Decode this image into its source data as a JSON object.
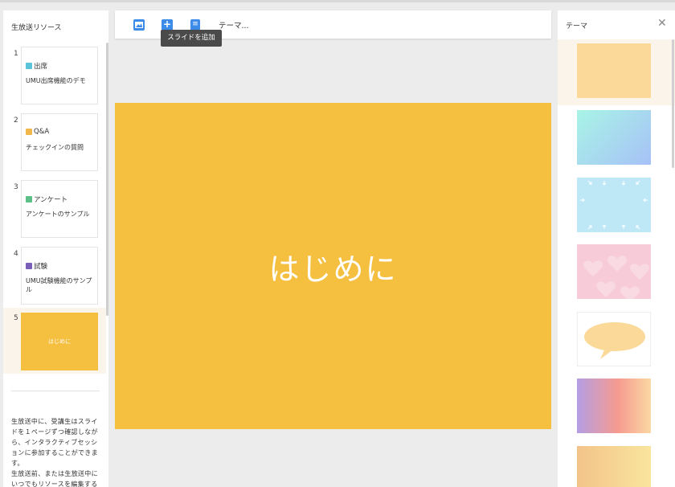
{
  "left_panel": {
    "title": "生放送リソース",
    "slides": [
      {
        "num": "1",
        "type": "出席",
        "color": "#5bc4d8",
        "subtitle": "UMU出席機能のデモ"
      },
      {
        "num": "2",
        "type": "Q&A",
        "color": "#f0b84a",
        "subtitle": "チェックインの質問"
      },
      {
        "num": "3",
        "type": "アンケート",
        "color": "#5cbf87",
        "subtitle": "アンケートのサンプル"
      },
      {
        "num": "4",
        "type": "試験",
        "color": "#7a5fb8",
        "subtitle": "UMU試験機能のサンプル"
      },
      {
        "num": "5",
        "thumb_text": "はじめに",
        "selected": true
      }
    ],
    "description": "生放送中に、受講生はスライドを１ページずつ確認しながら、インタラクティブセッションに参加することができます。\n生放送前、または生放送中にいつでもリソースを編集することができます。生放"
  },
  "toolbar": {
    "image_icon": "image-icon",
    "add_icon": "plus-icon",
    "list_icon": "document-icon",
    "theme_label": "テーマ...",
    "tooltip": "スライドを追加"
  },
  "main": {
    "slide_title": "はじめに",
    "slide_color": "#f5bf40"
  },
  "right_panel": {
    "title": "テーマ",
    "close_icon": "close-icon",
    "themes": [
      {
        "name": "theme-peach"
      },
      {
        "name": "theme-mint-blue-gradient"
      },
      {
        "name": "theme-sky-arrows"
      },
      {
        "name": "theme-pink-hearts"
      },
      {
        "name": "theme-speech-bubble"
      },
      {
        "name": "theme-sunset-gradient"
      },
      {
        "name": "theme-orange-gradient"
      }
    ]
  },
  "colors": {
    "accent": "#3d8be8",
    "slide_yellow": "#f5bf40",
    "selected_bg": "#fbf4ea"
  }
}
